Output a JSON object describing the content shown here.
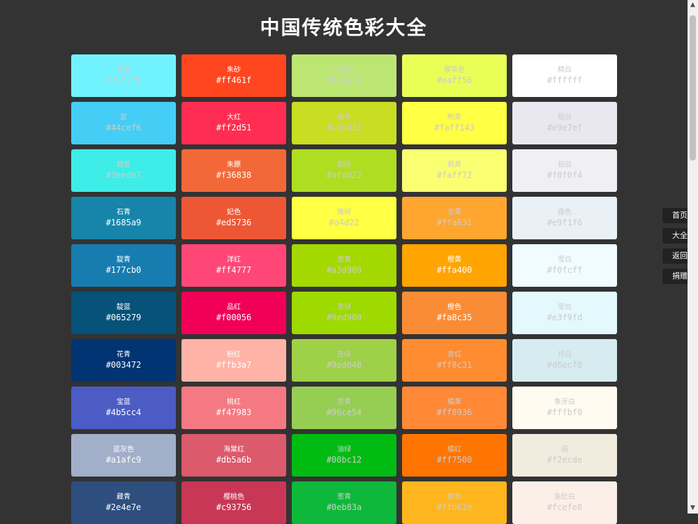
{
  "page": {
    "title": "中国传统色彩大全"
  },
  "colors": [
    {
      "name": "青蓝",
      "hex": "#70f3ff",
      "text": "light"
    },
    {
      "name": "朱砂",
      "hex": "#ff461f",
      "text": "dark"
    },
    {
      "name": "松花色",
      "hex": "#bce672",
      "text": "light"
    },
    {
      "name": "樱草色",
      "hex": "#eaff56",
      "text": "light"
    },
    {
      "name": "精白",
      "hex": "#ffffff",
      "text": "light"
    },
    {
      "name": "蓝",
      "hex": "#44cef6",
      "text": "light"
    },
    {
      "name": "大红",
      "hex": "#ff2d51",
      "text": "dark"
    },
    {
      "name": "柳黄",
      "hex": "#c9dd22",
      "text": "light"
    },
    {
      "name": "鸭黄",
      "hex": "#faff143",
      "text": "light"
    },
    {
      "name": "银白",
      "hex": "#e9e7ef",
      "text": "light"
    },
    {
      "name": "碧蓝",
      "hex": "#3eede7",
      "text": "light"
    },
    {
      "name": "朱膘",
      "hex": "#f36838",
      "text": "dark"
    },
    {
      "name": "柳绿",
      "hex": "#afdd22",
      "text": "light"
    },
    {
      "name": "鹅黄",
      "hex": "#faff72",
      "text": "light"
    },
    {
      "name": "铅白",
      "hex": "#f0f0f4",
      "text": "light"
    },
    {
      "name": "石青",
      "hex": "#1685a9",
      "text": "dark"
    },
    {
      "name": "妃色",
      "hex": "#ed5736",
      "text": "dark"
    },
    {
      "name": "嫩绿",
      "hex": "#a4d22",
      "text": "light"
    },
    {
      "name": "杏黄",
      "hex": "#ffa631",
      "text": "light"
    },
    {
      "name": "霜色",
      "hex": "#e9f1f6",
      "text": "light"
    },
    {
      "name": "靛青",
      "hex": "#177cb0",
      "text": "dark"
    },
    {
      "name": "洋红",
      "hex": "#ff4777",
      "text": "dark"
    },
    {
      "name": "葱黄",
      "hex": "#a3d900",
      "text": "light"
    },
    {
      "name": "橙黄",
      "hex": "#ffa400",
      "text": "dark"
    },
    {
      "name": "雪白",
      "hex": "#f0fcff",
      "text": "light"
    },
    {
      "name": "靛蓝",
      "hex": "#065279",
      "text": "dark"
    },
    {
      "name": "品红",
      "hex": "#f00056",
      "text": "dark"
    },
    {
      "name": "葱绿",
      "hex": "#9ed900",
      "text": "light"
    },
    {
      "name": "橙色",
      "hex": "#fa8c35",
      "text": "dark"
    },
    {
      "name": "莹白",
      "hex": "#e3f9fd",
      "text": "light"
    },
    {
      "name": "花青",
      "hex": "#003472",
      "text": "dark"
    },
    {
      "name": "粉红",
      "hex": "#ffb3a7",
      "text": "dark"
    },
    {
      "name": "豆绿",
      "hex": "#9ed048",
      "text": "light"
    },
    {
      "name": "杏红",
      "hex": "#ff8c31",
      "text": "light"
    },
    {
      "name": "月白",
      "hex": "#d6ecf0",
      "text": "light"
    },
    {
      "name": "宝蓝",
      "hex": "#4b5cc4",
      "text": "dark"
    },
    {
      "name": "桃红",
      "hex": "#f47983",
      "text": "dark"
    },
    {
      "name": "豆青",
      "hex": "#96ce54",
      "text": "light"
    },
    {
      "name": "橘黄",
      "hex": "#ff8936",
      "text": "light"
    },
    {
      "name": "象牙白",
      "hex": "#fffbf0",
      "text": "light"
    },
    {
      "name": "蓝灰色",
      "hex": "#a1afc9",
      "text": "dark"
    },
    {
      "name": "海棠红",
      "hex": "#db5a6b",
      "text": "dark"
    },
    {
      "name": "油绿",
      "hex": "#00bc12",
      "text": "light"
    },
    {
      "name": "橘红",
      "hex": "#ff7500",
      "text": "light"
    },
    {
      "name": "缟",
      "hex": "#f2ecde",
      "text": "light"
    },
    {
      "name": "藏青",
      "hex": "#2e4e7e",
      "text": "dark"
    },
    {
      "name": "樱桃色",
      "hex": "#c93756",
      "text": "dark"
    },
    {
      "name": "葱青",
      "hex": "#0eb83a",
      "text": "light"
    },
    {
      "name": "藤黄",
      "hex": "#ffb61e",
      "text": "light"
    },
    {
      "name": "鱼肚白",
      "hex": "#fcefe8",
      "text": "light"
    }
  ],
  "sidenav": [
    {
      "label": "首页"
    },
    {
      "label": "大全"
    },
    {
      "label": "返回"
    },
    {
      "label": "捐赠"
    }
  ]
}
